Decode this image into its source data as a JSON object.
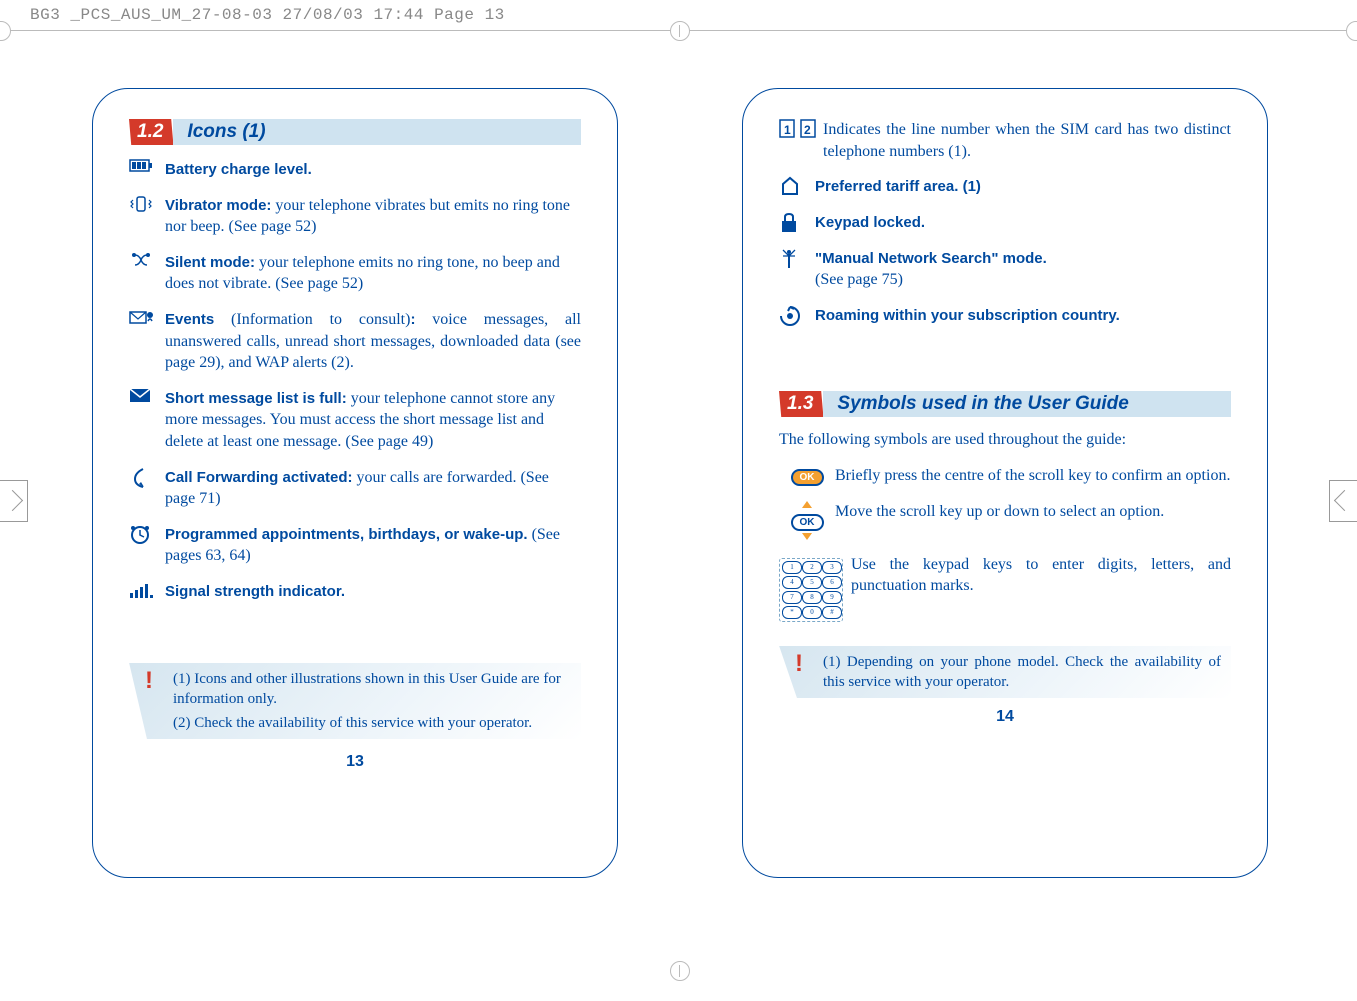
{
  "header": "BG3 _PCS_AUS_UM_27-08-03  27/08/03  17:44  Page 13",
  "page1": {
    "sec_num": "1.2",
    "sec_title": "Icons (1)",
    "items": [
      {
        "b": "Battery charge level."
      },
      {
        "b": "Vibrator mode:",
        "t": " your telephone vibrates but emits no ring tone nor beep. (See page 52)"
      },
      {
        "b": "Silent mode:",
        "t": " your telephone emits no ring tone, no beep and does not vibrate. (See page 52)"
      },
      {
        "b": "Events",
        "mid": " (Information to consult)",
        "b2": ":",
        "t": " voice messages, all unanswered calls, unread short messages, downloaded data (see page 29), and WAP alerts (2)."
      },
      {
        "b": "Short message list is full:",
        "t": " your telephone cannot store any more messages. You must access the short message list and delete at least one message. (See page 49)"
      },
      {
        "b": "Call Forwarding activated:",
        "t": " your calls are forwarded. (See page 71)"
      },
      {
        "b": "Programmed appointments, birthdays, or wake-up.",
        "t": " (See pages 63, 64)"
      },
      {
        "b": "Signal strength indicator."
      }
    ],
    "note1": "(1) Icons and other illustrations shown in this User Guide are for information only.",
    "note2": "(2) Check the availability of this service with your operator.",
    "pnum": "13"
  },
  "page2": {
    "items": [
      {
        "t": "Indicates the line number when the SIM card has two distinct telephone numbers (1)."
      },
      {
        "b": "Preferred tariff area. (1)"
      },
      {
        "b": "Keypad locked."
      },
      {
        "b": "\"Manual Network Search\" mode.",
        "t": " (See page 75)"
      },
      {
        "b": "Roaming within your subscription country."
      }
    ],
    "sec_num": "1.3",
    "sec_title": "Symbols used in the User Guide",
    "intro": "The following symbols are used throughout the guide:",
    "sym": [
      "Briefly press the centre of the scroll key to confirm an option.",
      "Move the scroll key up or down to select an option.",
      "Use the keypad keys to enter digits, letters, and punctuation marks."
    ],
    "note1": "(1) Depending on your phone model. Check the availability of this service with your operator.",
    "pnum": "14"
  }
}
